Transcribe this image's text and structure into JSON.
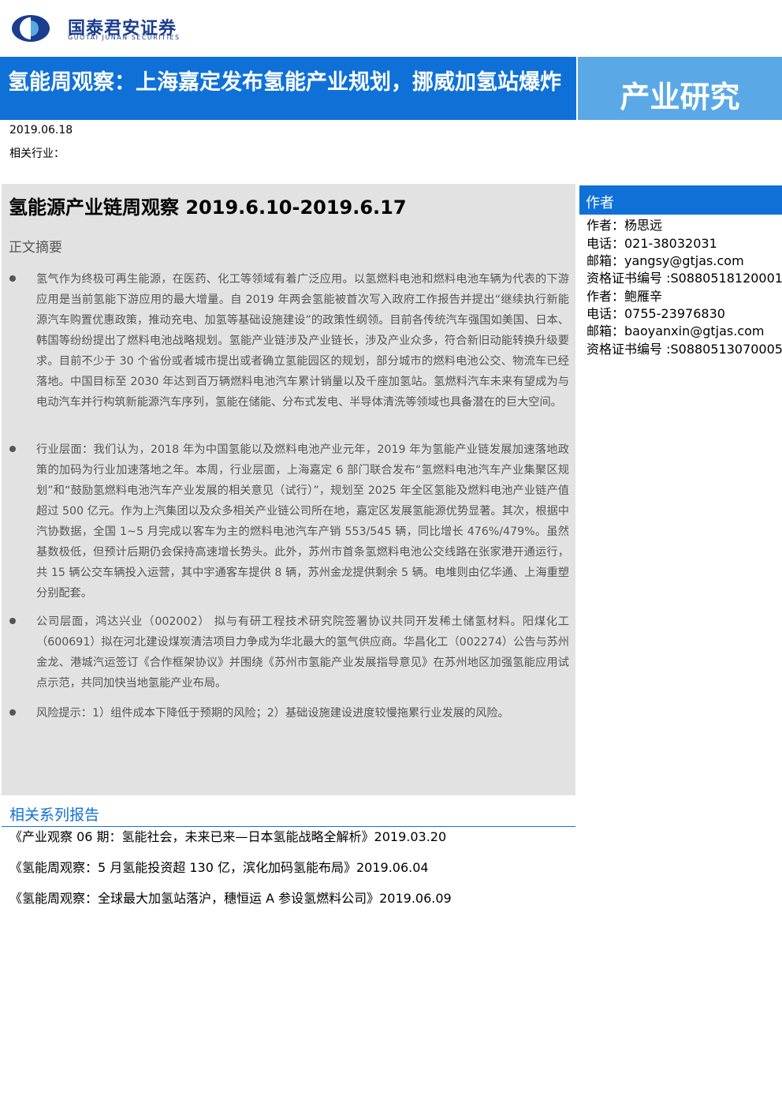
{
  "brand": {
    "name_cn": "国泰君安证券",
    "name_en": "GUOTAI JUNAN SECURITIES",
    "primary_color": "#0f71d8",
    "secondary_color": "#5aa9e6",
    "logo_color": "#1b3d8f"
  },
  "banner": {
    "title": "氢能周观察：上海嘉定发布氢能产业规划，挪威加氢站爆炸",
    "category": "产业研究"
  },
  "meta": {
    "date": "2019.06.18",
    "industry_label": "相关行业："
  },
  "summary": {
    "title": "氢能源产业链周观察 2019.6.10-2019.6.17",
    "label": "正文摘要",
    "bullets": [
      "氢气作为终极可再生能源，在医药、化工等领域有着广泛应用。以氢燃料电池和燃料电池车辆为代表的下游应用是当前氢能下游应用的最大增量。自 2019 年两会氢能被首次写入政府工作报告并提出“继续执行新能源汽车购置优惠政策，推动充电、加氢等基础设施建设”的政策性纲领。目前各传统汽车强国如美国、日本、韩国等纷纷提出了燃料电池战略规划。氢能产业链涉及产业链长，涉及产业众多，符合新旧动能转换升级要求。目前不少于 30 个省份或者城市提出或者确立氢能园区的规划，部分城市的燃料电池公交、物流车已经落地。中国目标至 2030 年达到百万辆燃料电池汽车累计销量以及千座加氢站。氢燃料汽车未来有望成为与电动汽车并行构筑新能源汽车序列，氢能在储能、分布式发电、半导体清洗等领域也具备潜在的巨大空间。",
      "行业层面：我们认为，2018 年为中国氢能以及燃料电池产业元年，2019 年为氢能产业链发展加速落地政策的加码为行业加速落地之年。本周，行业层面，上海嘉定 6 部门联合发布“氢燃料电池汽车产业集聚区规划”和“鼓励氢燃料电池汽车产业发展的相关意见（试行）”，规划至 2025 年全区氢能及燃料电池产业链产值超过 500 亿元。作为上汽集团以及众多相关产业链公司所在地，嘉定区发展氢能源优势显著。其次，根据中汽协数据，全国 1~5 月完成以客车为主的燃料电池汽车产销 553/545 辆，同比增长 476%/479%。虽然基数极低，但预计后期仍会保持高速增长势头。此外，苏州市首条氢燃料电池公交线路在张家港开通运行，共 15 辆公交车辆投入运营，其中宇通客车提供 8 辆，苏州金龙提供剩余 5 辆。电堆则由亿华通、上海重塑分别配套。",
      "公司层面，鸿达兴业（002002） 拟与有研工程技术研究院签署协议共同开发稀土储氢材料。阳煤化工（600691）拟在河北建设煤炭清洁项目力争成为华北最大的氢气供应商。华昌化工（002274）公告与苏州金龙、港城汽运签订《合作框架协议》并围绕《苏州市氢能产业发展指导意见》在苏州地区加强氢能应用试点示范，共同加快当地氢能产业布局。",
      "风险提示：1）组件成本下降低于预期的风险；2）基础设施建设进度较慢拖累行业发展的风险。"
    ]
  },
  "authors": {
    "header": "作者",
    "lines": [
      "作者：杨思远",
      "电话：021-38032031",
      "邮箱：yangsy@gtjas.com",
      "资格证书编号 :S0880518120001",
      "作者：鲍雁辛",
      "电话：0755-23976830",
      "邮箱：baoyanxin@gtjas.com",
      "资格证书编号 :S0880513070005"
    ]
  },
  "related": {
    "header": "相关系列报告",
    "items": [
      "《产业观察 06 期：氢能社会，未来已来—日本氢能战略全解析》2019.03.20",
      "《氢能周观察：5 月氢能投资超 130 亿，滨化加码氢能布局》2019.06.04",
      "《氢能周观察：全球最大加氢站落沪，穗恒运 A 参设氢燃料公司》2019.06.09"
    ]
  }
}
